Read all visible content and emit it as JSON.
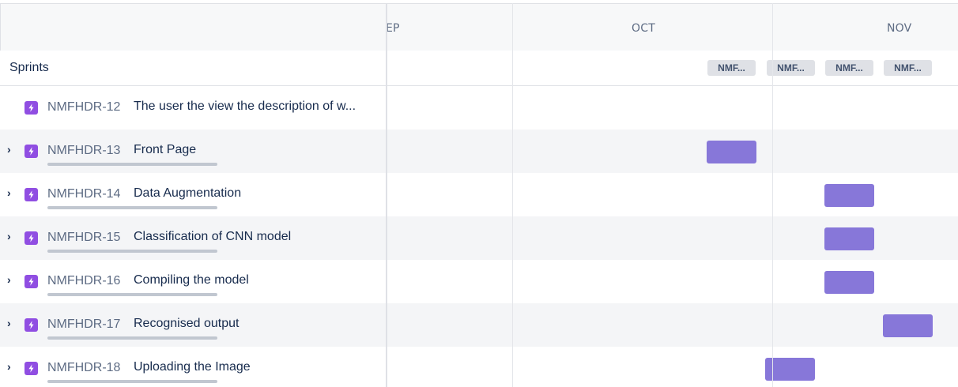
{
  "timeline": {
    "months": [
      "EP",
      "OCT",
      "NOV"
    ]
  },
  "sprints": {
    "label": "Sprints",
    "chips": [
      "NMF...",
      "NMF...",
      "NMF...",
      "NMF..."
    ]
  },
  "issues": [
    {
      "key": "NMFHDR-12",
      "summary": "The user the view the description of w...",
      "has_children": false
    },
    {
      "key": "NMFHDR-13",
      "summary": "Front Page",
      "has_children": true
    },
    {
      "key": "NMFHDR-14",
      "summary": "Data Augmentation",
      "has_children": true
    },
    {
      "key": "NMFHDR-15",
      "summary": "Classification of CNN model",
      "has_children": true
    },
    {
      "key": "NMFHDR-16",
      "summary": "Compiling the model",
      "has_children": true
    },
    {
      "key": "NMFHDR-17",
      "summary": "Recognised output",
      "has_children": true
    },
    {
      "key": "NMFHDR-18",
      "summary": "Uploading the Image",
      "has_children": true
    }
  ],
  "icons": {
    "expand": "chevron-right-icon",
    "issue_type": "epic-lightning-icon"
  },
  "colors": {
    "epic_icon": "#904ee2",
    "schedule_bar": "#8777d9",
    "sprint_chip": "#dfe1e6",
    "row_alt": "#f4f5f7"
  }
}
